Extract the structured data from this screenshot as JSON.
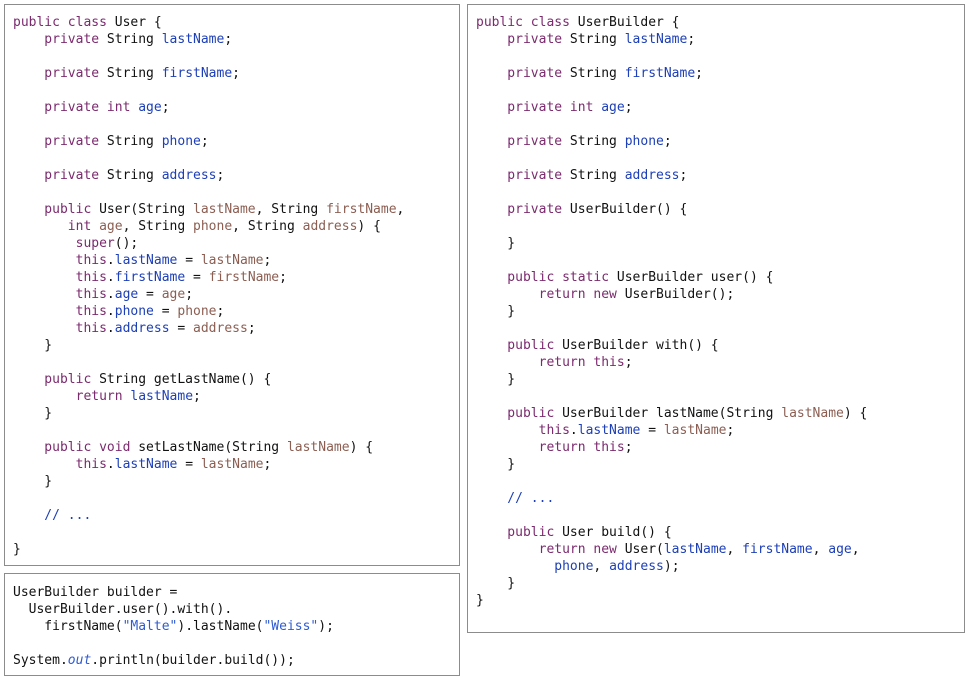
{
  "panels": {
    "user_class": {
      "lines": [
        [
          [
            "kw",
            "public class "
          ],
          [
            "tx",
            "User {"
          ]
        ],
        [
          [
            "kw",
            "    private "
          ],
          [
            "tx",
            "String "
          ],
          [
            "fd",
            "lastName"
          ],
          [
            "tx",
            ";"
          ]
        ],
        [],
        [
          [
            "kw",
            "    private "
          ],
          [
            "tx",
            "String "
          ],
          [
            "fd",
            "firstName"
          ],
          [
            "tx",
            ";"
          ]
        ],
        [],
        [
          [
            "kw",
            "    private int "
          ],
          [
            "fd",
            "age"
          ],
          [
            "tx",
            ";"
          ]
        ],
        [],
        [
          [
            "kw",
            "    private "
          ],
          [
            "tx",
            "String "
          ],
          [
            "fd",
            "phone"
          ],
          [
            "tx",
            ";"
          ]
        ],
        [],
        [
          [
            "kw",
            "    private "
          ],
          [
            "tx",
            "String "
          ],
          [
            "fd",
            "address"
          ],
          [
            "tx",
            ";"
          ]
        ],
        [],
        [
          [
            "kw",
            "    public "
          ],
          [
            "tx",
            "User(String "
          ],
          [
            "pr",
            "lastName"
          ],
          [
            "tx",
            ", String "
          ],
          [
            "pr",
            "firstName"
          ],
          [
            "tx",
            ","
          ]
        ],
        [
          [
            "kw",
            "       int "
          ],
          [
            "pr",
            "age"
          ],
          [
            "tx",
            ", String "
          ],
          [
            "pr",
            "phone"
          ],
          [
            "tx",
            ", String "
          ],
          [
            "pr",
            "address"
          ],
          [
            "tx",
            ") {"
          ]
        ],
        [
          [
            "kw",
            "        super"
          ],
          [
            "tx",
            "();"
          ]
        ],
        [
          [
            "kw",
            "        this"
          ],
          [
            "tx",
            "."
          ],
          [
            "fd",
            "lastName"
          ],
          [
            "tx",
            " = "
          ],
          [
            "pr",
            "lastName"
          ],
          [
            "tx",
            ";"
          ]
        ],
        [
          [
            "kw",
            "        this"
          ],
          [
            "tx",
            "."
          ],
          [
            "fd",
            "firstName"
          ],
          [
            "tx",
            " = "
          ],
          [
            "pr",
            "firstName"
          ],
          [
            "tx",
            ";"
          ]
        ],
        [
          [
            "kw",
            "        this"
          ],
          [
            "tx",
            "."
          ],
          [
            "fd",
            "age"
          ],
          [
            "tx",
            " = "
          ],
          [
            "pr",
            "age"
          ],
          [
            "tx",
            ";"
          ]
        ],
        [
          [
            "kw",
            "        this"
          ],
          [
            "tx",
            "."
          ],
          [
            "fd",
            "phone"
          ],
          [
            "tx",
            " = "
          ],
          [
            "pr",
            "phone"
          ],
          [
            "tx",
            ";"
          ]
        ],
        [
          [
            "kw",
            "        this"
          ],
          [
            "tx",
            "."
          ],
          [
            "fd",
            "address"
          ],
          [
            "tx",
            " = "
          ],
          [
            "pr",
            "address"
          ],
          [
            "tx",
            ";"
          ]
        ],
        [
          [
            "tx",
            "    }"
          ]
        ],
        [],
        [
          [
            "kw",
            "    public "
          ],
          [
            "tx",
            "String getLastName() {"
          ]
        ],
        [
          [
            "kw",
            "        return "
          ],
          [
            "fd",
            "lastName"
          ],
          [
            "tx",
            ";"
          ]
        ],
        [
          [
            "tx",
            "    }"
          ]
        ],
        [],
        [
          [
            "kw",
            "    public void "
          ],
          [
            "tx",
            "setLastName(String "
          ],
          [
            "pr",
            "lastName"
          ],
          [
            "tx",
            ") {"
          ]
        ],
        [
          [
            "kw",
            "        this"
          ],
          [
            "tx",
            "."
          ],
          [
            "fd",
            "lastName"
          ],
          [
            "tx",
            " = "
          ],
          [
            "pr",
            "lastName"
          ],
          [
            "tx",
            ";"
          ]
        ],
        [
          [
            "tx",
            "    }"
          ]
        ],
        [],
        [
          [
            "cm",
            "    // ..."
          ]
        ],
        [],
        [
          [
            "tx",
            "}"
          ]
        ]
      ]
    },
    "usage": {
      "lines": [
        [
          [
            "tx",
            "UserBuilder builder ="
          ]
        ],
        [
          [
            "tx",
            "  UserBuilder.user().with()."
          ]
        ],
        [
          [
            "tx",
            "    firstName("
          ],
          [
            "st",
            "\"Malte\""
          ],
          [
            "tx",
            ").lastName("
          ],
          [
            "st",
            "\"Weiss\""
          ],
          [
            "tx",
            ");"
          ]
        ],
        [],
        [
          [
            "tx",
            "System."
          ],
          [
            "it",
            "out"
          ],
          [
            "tx",
            ".println(builder.build());"
          ]
        ]
      ]
    },
    "builder_class": {
      "lines": [
        [
          [
            "kw",
            "public class "
          ],
          [
            "tx",
            "UserBuilder {"
          ]
        ],
        [
          [
            "kw",
            "    private "
          ],
          [
            "tx",
            "String "
          ],
          [
            "fd",
            "lastName"
          ],
          [
            "tx",
            ";"
          ]
        ],
        [],
        [
          [
            "kw",
            "    private "
          ],
          [
            "tx",
            "String "
          ],
          [
            "fd",
            "firstName"
          ],
          [
            "tx",
            ";"
          ]
        ],
        [],
        [
          [
            "kw",
            "    private int "
          ],
          [
            "fd",
            "age"
          ],
          [
            "tx",
            ";"
          ]
        ],
        [],
        [
          [
            "kw",
            "    private "
          ],
          [
            "tx",
            "String "
          ],
          [
            "fd",
            "phone"
          ],
          [
            "tx",
            ";"
          ]
        ],
        [],
        [
          [
            "kw",
            "    private "
          ],
          [
            "tx",
            "String "
          ],
          [
            "fd",
            "address"
          ],
          [
            "tx",
            ";"
          ]
        ],
        [],
        [
          [
            "kw",
            "    private "
          ],
          [
            "tx",
            "UserBuilder() {"
          ]
        ],
        [],
        [
          [
            "tx",
            "    }"
          ]
        ],
        [],
        [
          [
            "kw",
            "    public static "
          ],
          [
            "tx",
            "UserBuilder user() {"
          ]
        ],
        [
          [
            "kw",
            "        return new "
          ],
          [
            "tx",
            "UserBuilder();"
          ]
        ],
        [
          [
            "tx",
            "    }"
          ]
        ],
        [],
        [
          [
            "kw",
            "    public "
          ],
          [
            "tx",
            "UserBuilder with() {"
          ]
        ],
        [
          [
            "kw",
            "        return this"
          ],
          [
            "tx",
            ";"
          ]
        ],
        [
          [
            "tx",
            "    }"
          ]
        ],
        [],
        [
          [
            "kw",
            "    public "
          ],
          [
            "tx",
            "UserBuilder lastName(String "
          ],
          [
            "pr",
            "lastName"
          ],
          [
            "tx",
            ") {"
          ]
        ],
        [
          [
            "kw",
            "        this"
          ],
          [
            "tx",
            "."
          ],
          [
            "fd",
            "lastName"
          ],
          [
            "tx",
            " = "
          ],
          [
            "pr",
            "lastName"
          ],
          [
            "tx",
            ";"
          ]
        ],
        [
          [
            "kw",
            "        return this"
          ],
          [
            "tx",
            ";"
          ]
        ],
        [
          [
            "tx",
            "    }"
          ]
        ],
        [],
        [
          [
            "cm",
            "    // ..."
          ]
        ],
        [],
        [
          [
            "kw",
            "    public "
          ],
          [
            "tx",
            "User build() {"
          ]
        ],
        [
          [
            "kw",
            "        return new "
          ],
          [
            "tx",
            "User("
          ],
          [
            "fd",
            "lastName"
          ],
          [
            "tx",
            ", "
          ],
          [
            "fd",
            "firstName"
          ],
          [
            "tx",
            ", "
          ],
          [
            "fd",
            "age"
          ],
          [
            "tx",
            ","
          ]
        ],
        [
          [
            "tx",
            "          "
          ],
          [
            "fd",
            "phone"
          ],
          [
            "tx",
            ", "
          ],
          [
            "fd",
            "address"
          ],
          [
            "tx",
            ");"
          ]
        ],
        [
          [
            "tx",
            "    }"
          ]
        ],
        [
          [
            "tx",
            "}"
          ]
        ]
      ]
    }
  },
  "colors": {
    "keyword": "#7b2a6e",
    "field": "#1d3fb7",
    "parameter": "#8c5e52",
    "string": "#2f5bd1",
    "text": "#111111",
    "border": "#8c8c8c"
  }
}
